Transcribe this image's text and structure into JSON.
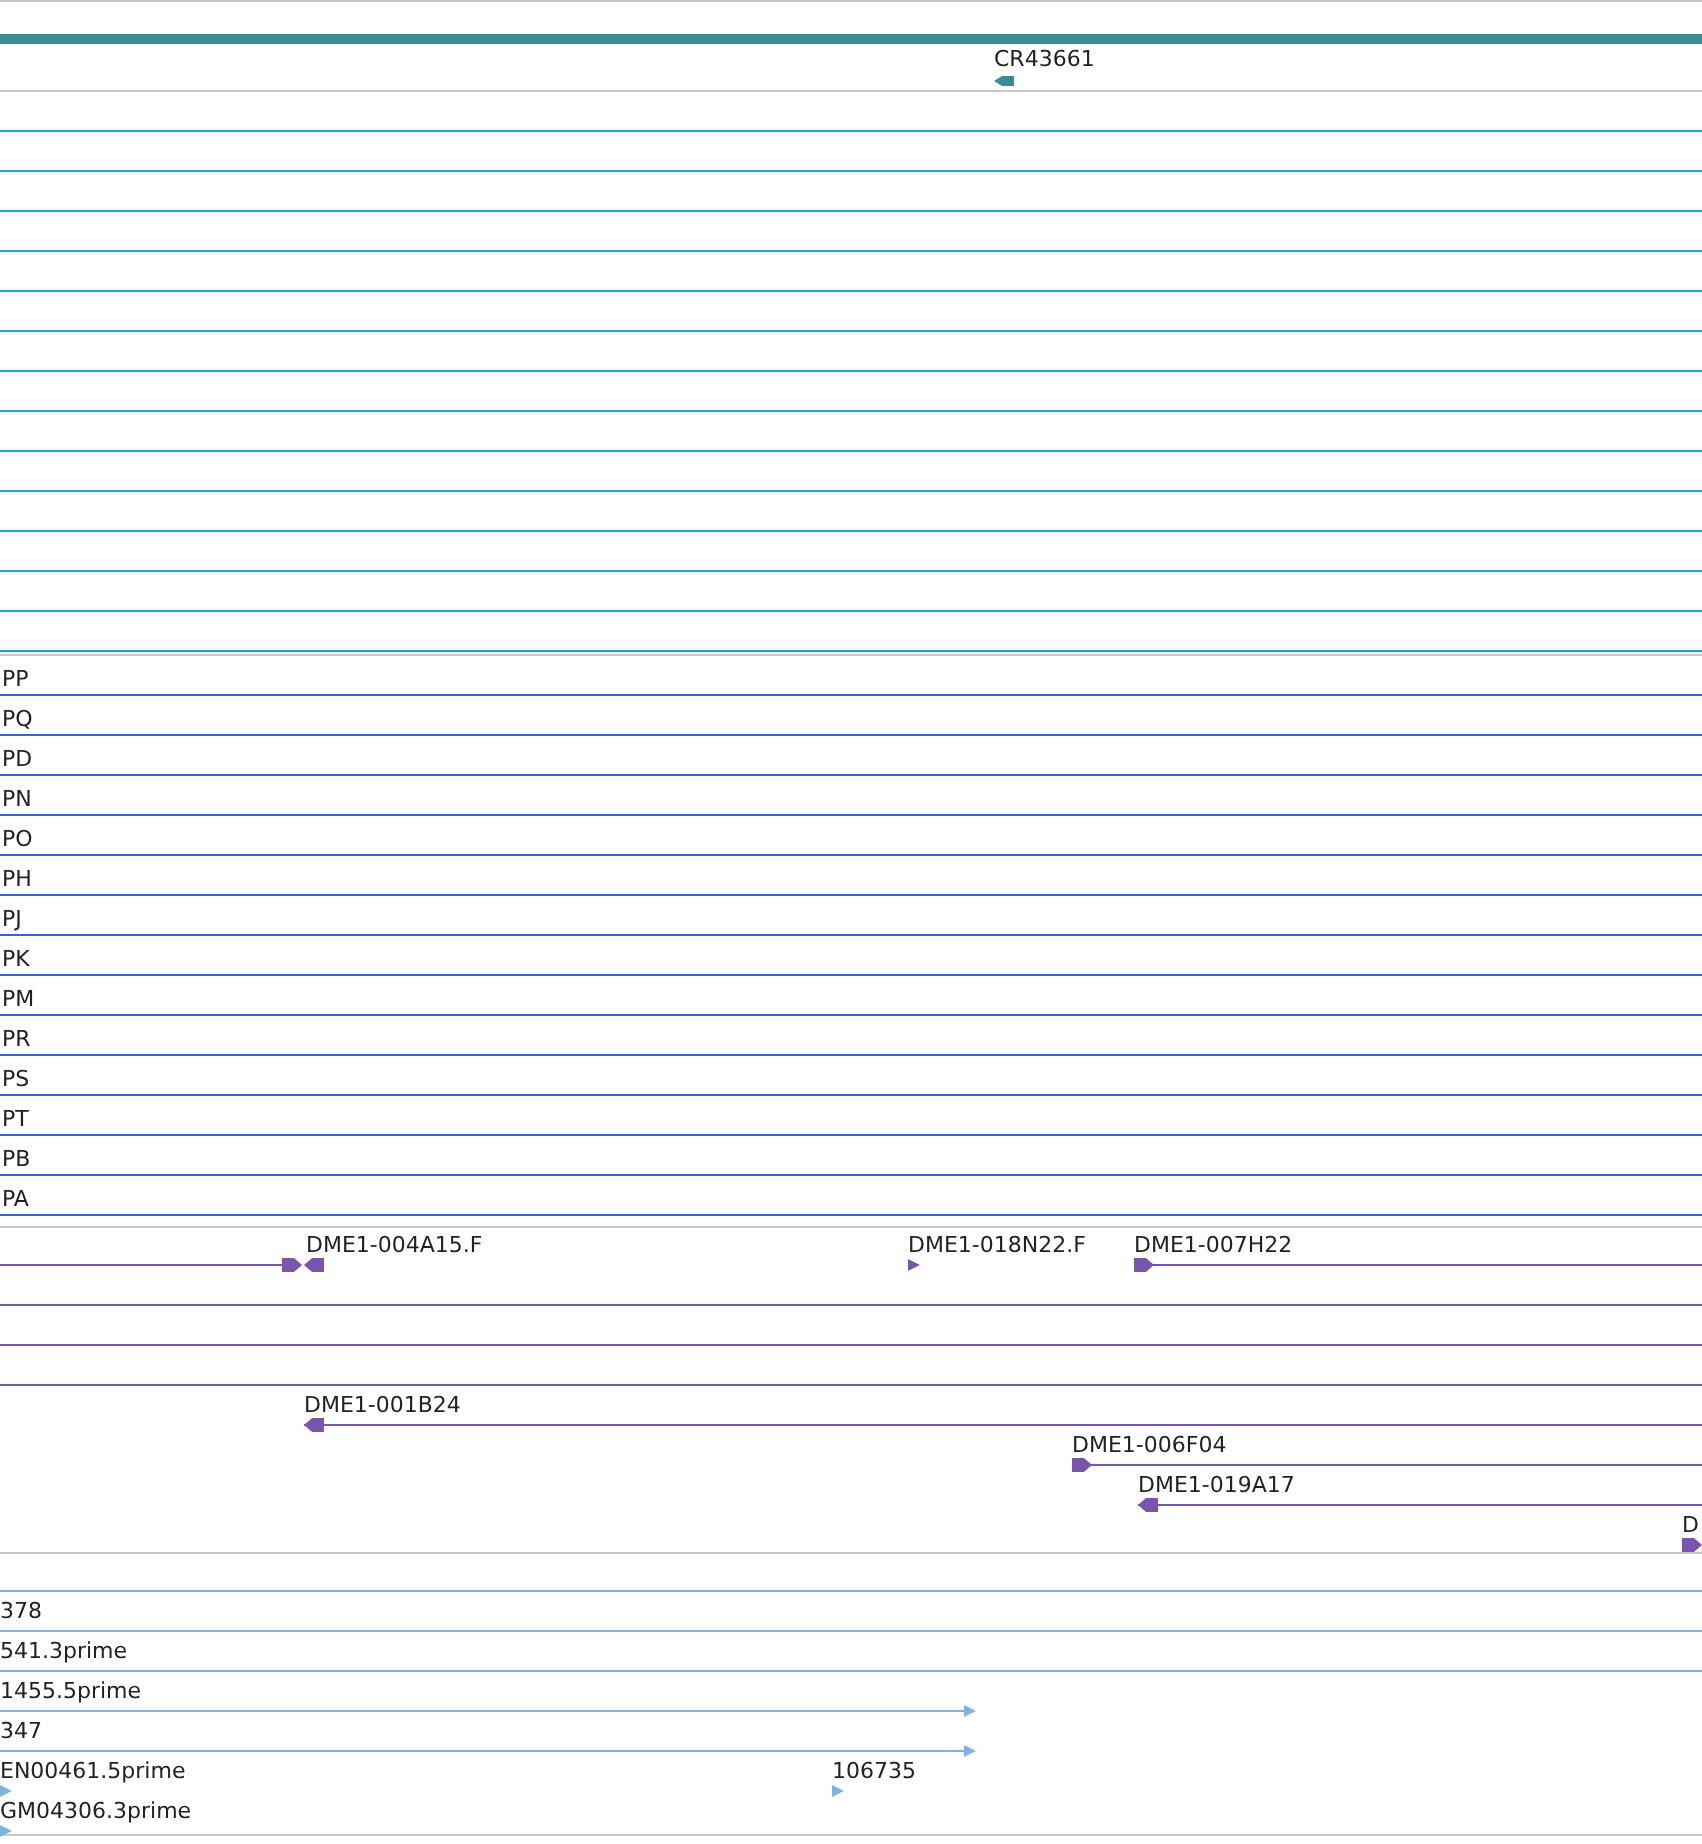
{
  "tracks": [
    {
      "kind": "gene",
      "color": "#3a8d93",
      "features": [
        {
          "label": "CR43661"
        }
      ]
    },
    {
      "kind": "empty",
      "color": "#1aa6c6"
    },
    {
      "kind": "list",
      "color": "#2b6ad2",
      "features": [
        {
          "label": "PP"
        },
        {
          "label": "PQ"
        },
        {
          "label": "PD"
        },
        {
          "label": "PN"
        },
        {
          "label": "PO"
        },
        {
          "label": "PH"
        },
        {
          "label": "PJ"
        },
        {
          "label": "PK"
        },
        {
          "label": "PM"
        },
        {
          "label": "PR"
        },
        {
          "label": "PS"
        },
        {
          "label": "PT"
        },
        {
          "label": "PB"
        },
        {
          "label": "PA"
        }
      ]
    },
    {
      "kind": "features",
      "color": "#7a55ad",
      "features": [
        {
          "label": "DME1-004A15.F"
        },
        {
          "label": "DME1-018N22.F"
        },
        {
          "label": "DME1-007H22"
        },
        {
          "label": "DME1-001B24"
        },
        {
          "label": "DME1-006F04"
        },
        {
          "label": "DME1-019A17"
        },
        {
          "label": "D"
        }
      ]
    },
    {
      "kind": "features",
      "color": "#7ab4e0",
      "features": [
        {
          "label": "378"
        },
        {
          "label": "541.3prime"
        },
        {
          "label": "1455.5prime"
        },
        {
          "label": "347"
        },
        {
          "label": "EN00461.5prime"
        },
        {
          "label": "106735"
        },
        {
          "label": "GM04306.3prime"
        }
      ]
    }
  ]
}
